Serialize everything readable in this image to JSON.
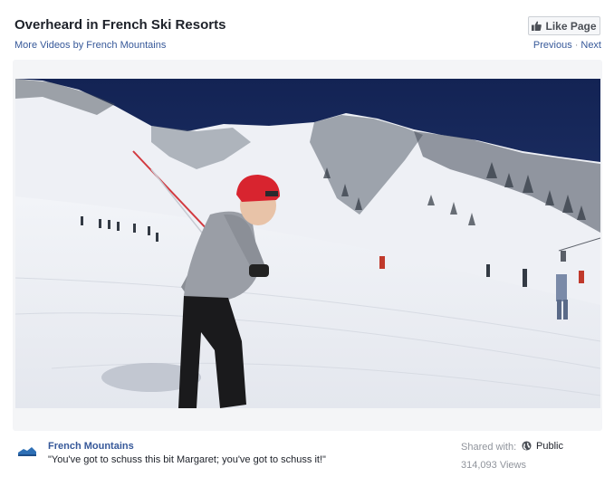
{
  "header": {
    "title": "Overheard in French Ski Resorts",
    "more_videos": "More Videos by French Mountains",
    "like_button": "Like Page",
    "previous": "Previous",
    "separator": "·",
    "next": "Next"
  },
  "video": {
    "description": "Skier in red helmet and grey jacket skiing down snowy slope with other skiers and chairlift in background"
  },
  "footer": {
    "page_name": "French Mountains",
    "caption": "\"You've got to schuss this bit Margaret; you've got to schuss it!\"",
    "shared_with_label": "Shared with:",
    "privacy": "Public",
    "views": "314,093 Views"
  },
  "colors": {
    "link": "#365899",
    "meta_text": "#90949c",
    "button_bg": "#f6f7f9",
    "sky": "#1c2f63",
    "helmet": "#d8242f"
  },
  "icons": {
    "like": "thumbs-up-icon",
    "privacy": "globe-icon",
    "page": "page-logo-icon"
  }
}
